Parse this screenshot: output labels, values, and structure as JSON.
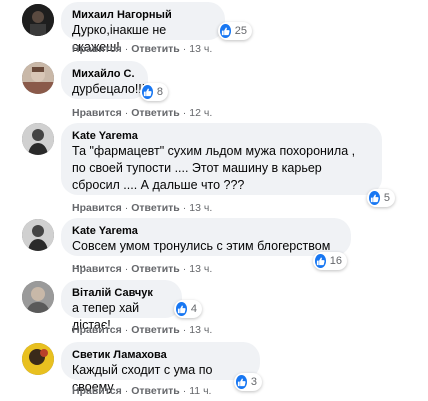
{
  "like_action": "Нравится",
  "reply_action": "Ответить",
  "separator": "·",
  "colors": {
    "like": "#1877f2",
    "bubble": "#f0f2f5",
    "meta": "#65676b"
  },
  "comments": [
    {
      "author": "Михаил Нагорный",
      "text": "Дурко,інакше не скажеш!",
      "likes": "25",
      "time": "13 ч."
    },
    {
      "author": "Михайло С.",
      "text": "дурбецало!!!",
      "likes": "8",
      "time": "12 ч."
    },
    {
      "author": "Kate Yarema",
      "text": "Та \"фармацевт\" сухим льдом мужа похоронила , по своей тупости .... Этот машину в карьер сбросил .... А дальше что ???",
      "likes": "5",
      "time": "13 ч."
    },
    {
      "author": "Kate Yarema",
      "text": "Совсем умом тронулись с этим блогерством ....",
      "likes": "16",
      "time": "13 ч."
    },
    {
      "author": "Віталій Савчук",
      "text": "а тепер хай дістає!",
      "likes": "4",
      "time": "13 ч."
    },
    {
      "author": "Светик Ламахова",
      "text": "Каждый сходит с ума по своему",
      "likes": "3",
      "time": "11 ч."
    }
  ]
}
